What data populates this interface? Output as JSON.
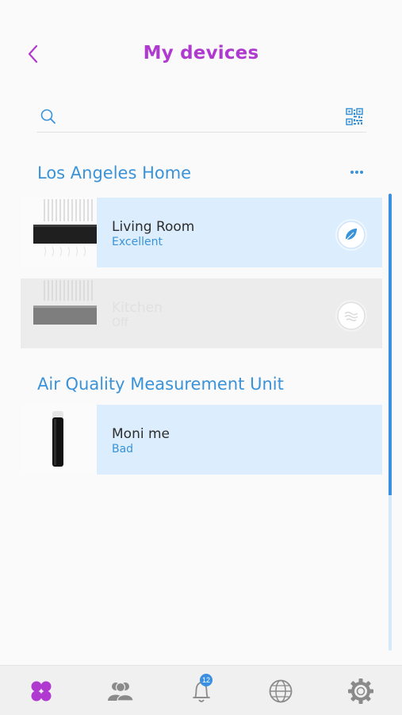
{
  "header": {
    "title": "My devices"
  },
  "search": {
    "placeholder": "",
    "value": ""
  },
  "groups": [
    {
      "title": "Los Angeles Home",
      "devices": [
        {
          "name": "Living Room",
          "status": "Excellent",
          "state": "on"
        },
        {
          "name": "Kitchen",
          "status": "Off",
          "state": "off"
        }
      ]
    },
    {
      "title": "Air Quality Measurement Unit",
      "devices": [
        {
          "name": "Moni me",
          "status": "Bad"
        }
      ]
    }
  ],
  "tabbar": {
    "tabs": [
      {
        "icon": "devices-icon",
        "active": true
      },
      {
        "icon": "users-icon",
        "active": false
      },
      {
        "icon": "bell-icon",
        "active": false,
        "badge": "12"
      },
      {
        "icon": "globe-icon",
        "active": false
      },
      {
        "icon": "gear-icon",
        "active": false
      }
    ]
  },
  "colors": {
    "accent": "#b03ad0",
    "primary": "#3a93d8",
    "card": "#dcedfd",
    "card_off": "#ececec",
    "icon_gray": "#8a8a8a"
  }
}
